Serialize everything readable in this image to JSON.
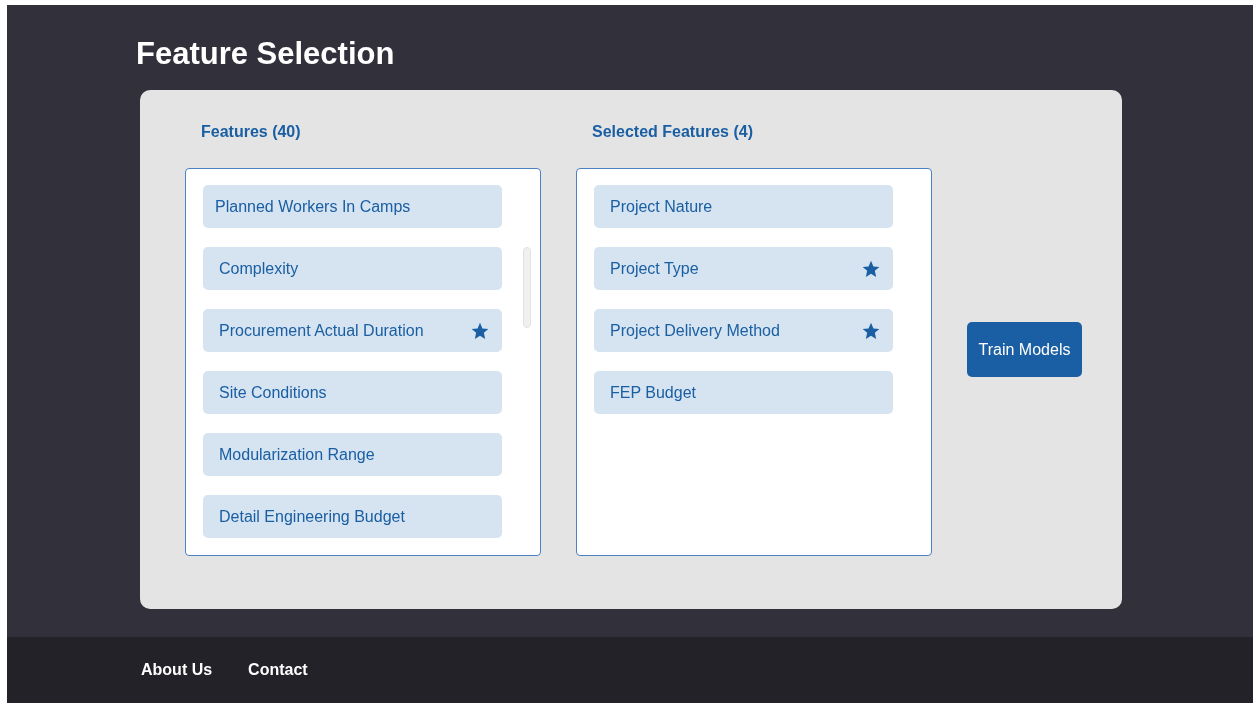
{
  "page_title": "Feature Selection",
  "features": {
    "heading": "Features (40)",
    "items": [
      {
        "label": "Planned Workers In Camps",
        "starred": false
      },
      {
        "label": "Complexity",
        "starred": false
      },
      {
        "label": "Procurement Actual Duration",
        "starred": true
      },
      {
        "label": "Site Conditions",
        "starred": false
      },
      {
        "label": "Modularization Range",
        "starred": false
      },
      {
        "label": "Detail Engineering Budget",
        "starred": false
      }
    ]
  },
  "selected_features": {
    "heading": "Selected Features (4)",
    "items": [
      {
        "label": "Project Nature",
        "starred": false
      },
      {
        "label": "Project Type",
        "starred": true
      },
      {
        "label": "Project Delivery Method",
        "starred": true
      },
      {
        "label": "FEP Budget",
        "starred": false
      }
    ]
  },
  "train_button": "Train Models",
  "footer_links": [
    "About Us",
    "Contact"
  ]
}
